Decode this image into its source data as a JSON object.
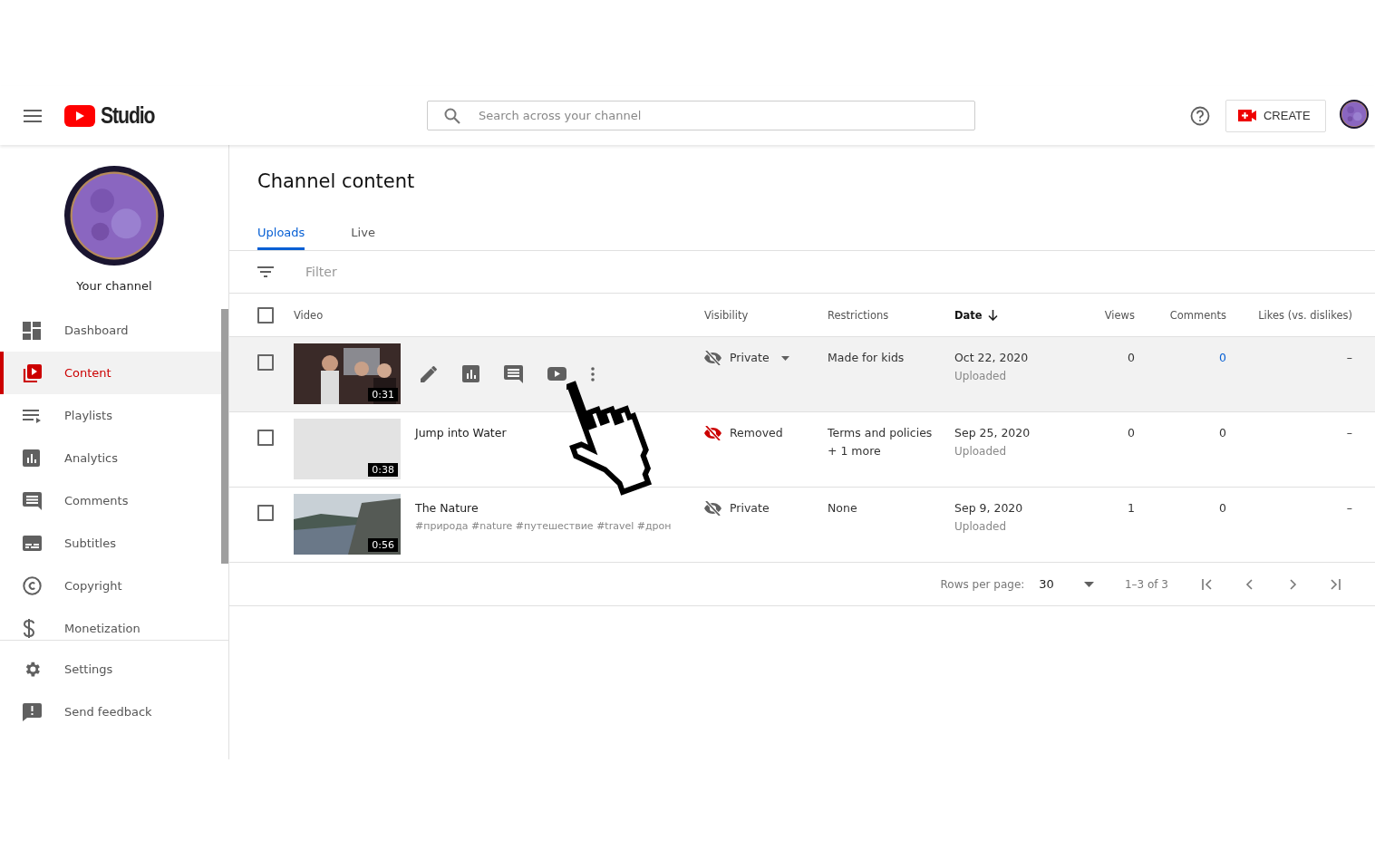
{
  "header": {
    "logo_text": "Studio",
    "search": {
      "placeholder": "Search across your channel"
    },
    "create_button": "CREATE"
  },
  "sidebar": {
    "channel_label": "Your channel",
    "items": [
      {
        "label": "Dashboard",
        "selected": false
      },
      {
        "label": "Content",
        "selected": true
      },
      {
        "label": "Playlists",
        "selected": false
      },
      {
        "label": "Analytics",
        "selected": false
      },
      {
        "label": "Comments",
        "selected": false
      },
      {
        "label": "Subtitles",
        "selected": false
      },
      {
        "label": "Copyright",
        "selected": false
      },
      {
        "label": "Monetization",
        "selected": false
      }
    ],
    "footer_items": [
      {
        "label": "Settings"
      },
      {
        "label": "Send feedback"
      }
    ]
  },
  "main": {
    "title": "Channel content",
    "tabs": [
      {
        "label": "Uploads",
        "selected": true
      },
      {
        "label": "Live",
        "selected": false
      }
    ],
    "filter": {
      "placeholder": "Filter"
    },
    "table": {
      "select_all_checked": false,
      "columns": [
        {
          "label": "Video",
          "sorted": false
        },
        {
          "label": "Visibility",
          "sorted": false
        },
        {
          "label": "Restrictions",
          "sorted": false
        },
        {
          "label": "Date",
          "sorted": true
        },
        {
          "label": "Views",
          "sorted": false
        },
        {
          "label": "Comments",
          "sorted": false
        },
        {
          "label": "Likes (vs. dislikes)",
          "sorted": false
        }
      ],
      "rows": [
        {
          "checked": false,
          "hovered": true,
          "duration": "0:31",
          "visibility": {
            "kind": "private",
            "label": "Private"
          },
          "restrictions": [
            "Made for kids"
          ],
          "date": "Oct 22, 2020",
          "date_note": "Uploaded",
          "views": "0",
          "comments": "0",
          "likes": "–"
        },
        {
          "checked": false,
          "hovered": false,
          "duration": "0:38",
          "title": "Jump into Water",
          "visibility": {
            "kind": "removed",
            "label": "Removed"
          },
          "restrictions": [
            "Terms and policies",
            "+ 1 more"
          ],
          "date": "Sep 25, 2020",
          "date_note": "Uploaded",
          "views": "0",
          "comments": "0",
          "likes": "–"
        },
        {
          "checked": false,
          "hovered": false,
          "duration": "0:56",
          "title": "The Nature",
          "description": "#природа #nature #путешествие #travel #дрон",
          "visibility": {
            "kind": "private",
            "label": "Private"
          },
          "restrictions": [
            "None"
          ],
          "date": "Sep 9, 2020",
          "date_note": "Uploaded",
          "views": "1",
          "comments": "0",
          "likes": "–"
        }
      ]
    },
    "pagination": {
      "rows_label": "Rows per page:",
      "rows_value": "30",
      "range": "1–3 of 3"
    }
  }
}
